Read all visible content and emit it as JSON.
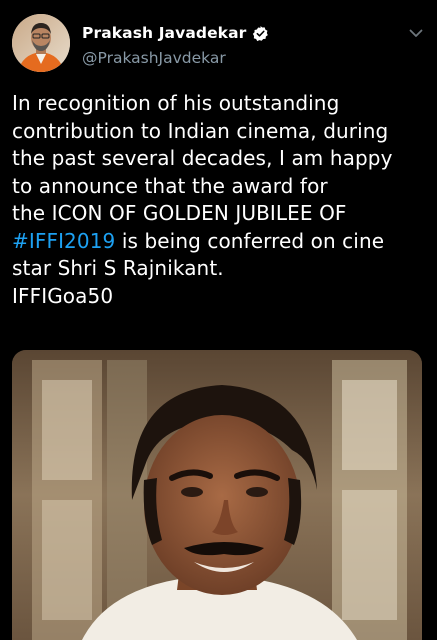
{
  "tweet": {
    "author": {
      "display_name": "Prakash Javadekar",
      "handle": "@PrakashJavdekar",
      "verified": true,
      "avatar_icon": "user-avatar-photo"
    },
    "menu_icon": "chevron-down-icon",
    "text_lines": {
      "l1": "In recognition of his outstanding",
      "l2": "contribution to Indian cinema, during",
      "l3": "the past several decades, I am happy",
      "l4": "to announce that the award for",
      "l5": "the ICON OF GOLDEN JUBILEE OF",
      "l6_hashtag": "#IFFI2019",
      "l6_rest": " is being conferred on cine",
      "l7": "star Shri S Rajnikant.",
      "l8": "IFFIGoa50"
    },
    "media": {
      "type": "photo"
    }
  },
  "colors": {
    "background": "#000000",
    "text": "#ffffff",
    "secondary": "#8899a6",
    "link": "#1da1f2",
    "verified_badge": "#ffffff"
  }
}
